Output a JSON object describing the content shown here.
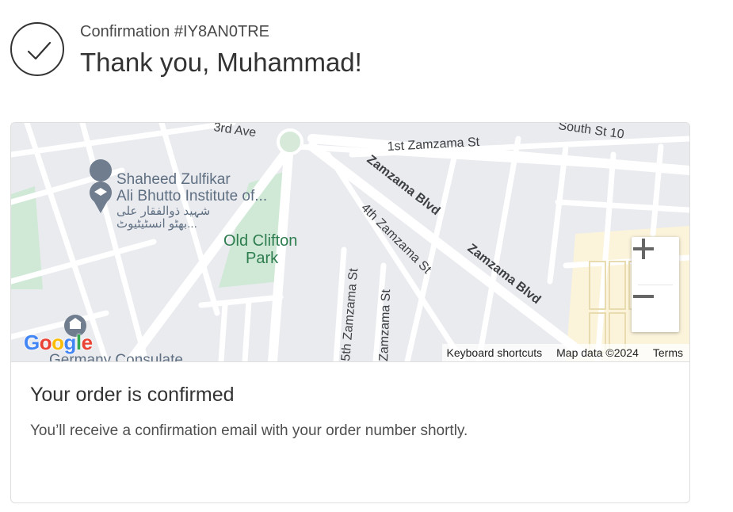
{
  "header": {
    "confirmation": "Confirmation #IY8AN0TRE",
    "thanks": "Thank you, Muhammad!"
  },
  "map": {
    "labels": {
      "ave3": "3rd Ave",
      "south10": "South St 10",
      "zamzama1st": "1st Zamzama St",
      "zamzamaBlvd": "Zamzama Blvd",
      "zamzama4th": "4th Zamzama St",
      "poi1": "Shaheed Zulfikar",
      "poi2": "Ali Bhutto Institute of...",
      "poi_ur1": "شہید ذوالفقار علی",
      "poi_ur2": "بھٹو انسٹیٹیوٹ...",
      "park1": "Old Clifton",
      "park2": "Park",
      "zamzamaSt": "Zamzama St",
      "zamzama5th": "5th Zamzama St",
      "consulate": "Germany Consulate"
    },
    "google": [
      "G",
      "o",
      "o",
      "g",
      "l",
      "e"
    ],
    "google_colors": [
      "#4285F4",
      "#EA4335",
      "#FBBC05",
      "#4285F4",
      "#34A853",
      "#EA4335"
    ],
    "zoom_in_icon": "plus-icon",
    "zoom_out_icon": "minus-icon",
    "attribution": {
      "keyboard": "Keyboard shortcuts",
      "mapdata": "Map data ©2024",
      "terms": "Terms"
    }
  },
  "order": {
    "title": "Your order is confirmed",
    "description": "You’ll receive a confirmation email with your order number shortly."
  }
}
